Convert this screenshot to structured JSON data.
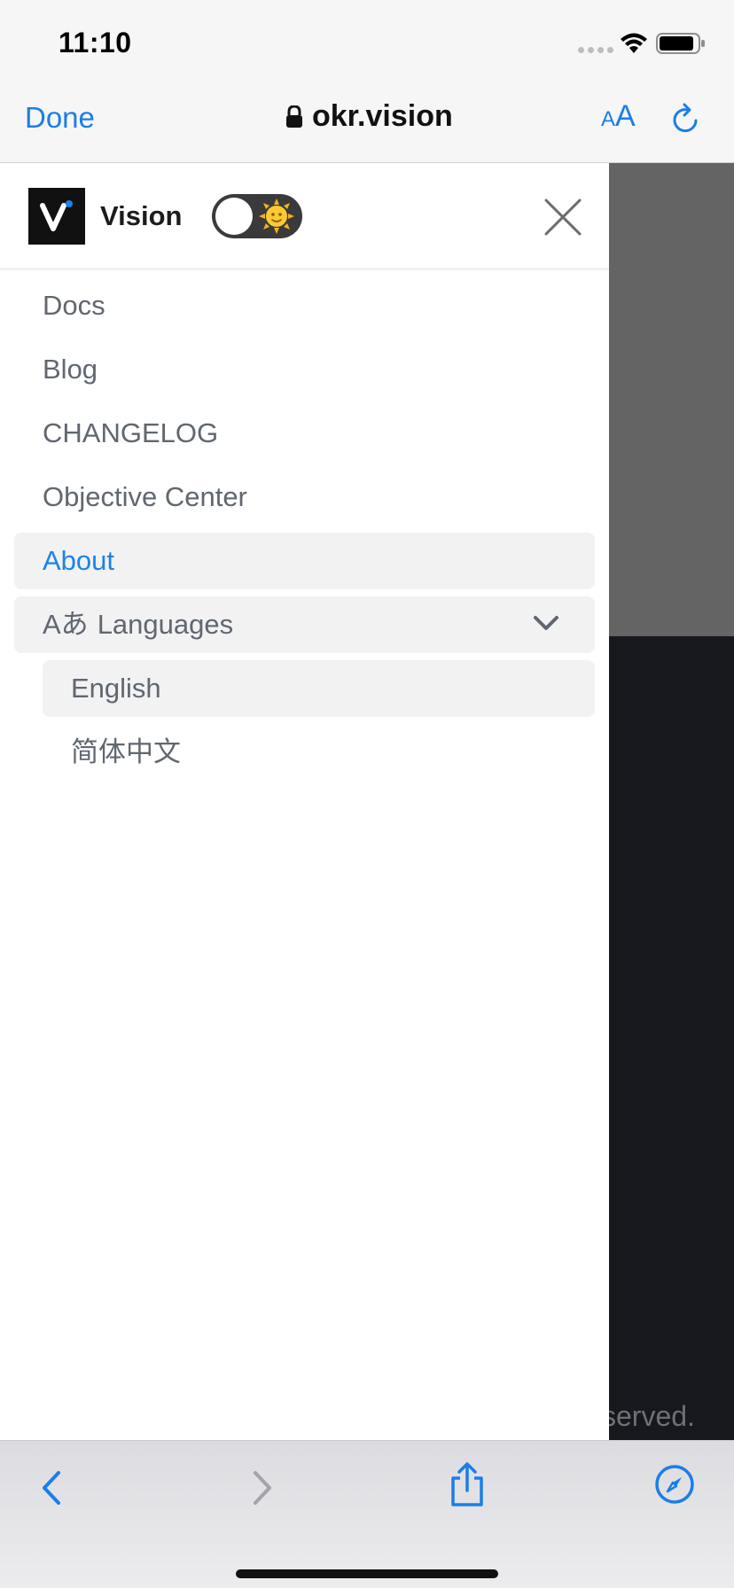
{
  "status_bar": {
    "time": "11:10"
  },
  "browser": {
    "done_label": "Done",
    "url": "okr.vision",
    "text_size_small": "A",
    "text_size_large": "A"
  },
  "drawer": {
    "brand": "Vision",
    "theme_toggle": {
      "state": "light",
      "icon": "sun-emoji"
    },
    "menu": [
      {
        "label": "Docs"
      },
      {
        "label": "Blog"
      },
      {
        "label": "CHANGELOG"
      },
      {
        "label": "Objective Center"
      },
      {
        "label": "About",
        "active": true
      }
    ],
    "languages": {
      "icon_text": "Aあ",
      "label": "Languages",
      "expanded": true,
      "options": [
        {
          "label": "English",
          "selected": true
        },
        {
          "label": "简体中文"
        }
      ]
    }
  },
  "backdrop": {
    "footer_text_fragment": "served."
  },
  "colors": {
    "accent": "#1a84e8",
    "menu_text": "#606770",
    "active_bg": "#f2f2f3",
    "backdrop_dark": "#16181d"
  }
}
